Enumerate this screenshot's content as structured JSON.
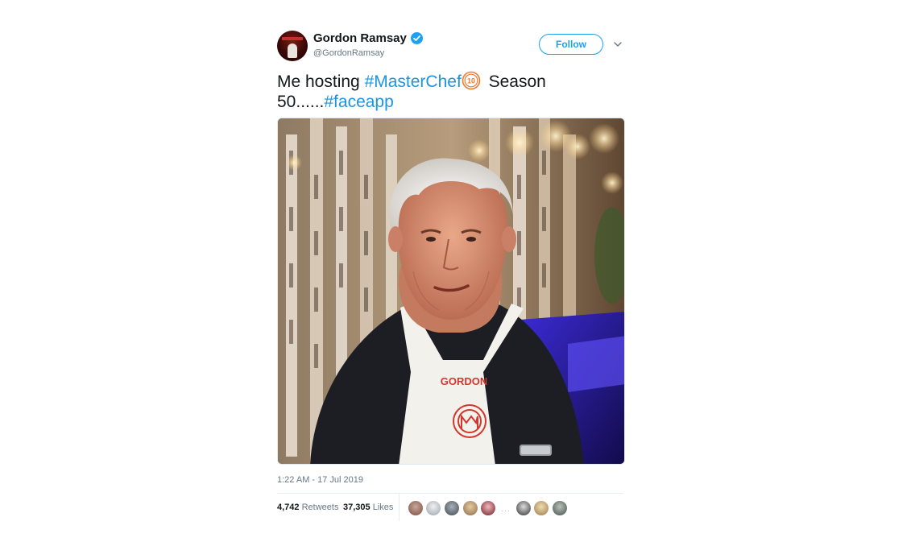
{
  "author": {
    "name": "Gordon Ramsay",
    "handle": "@GordonRamsay",
    "avatar_icon": "avatar-image",
    "verified": true
  },
  "actions": {
    "follow_label": "Follow",
    "menu_icon": "chevron-down-icon"
  },
  "tweet": {
    "text_part1": "Me hosting ",
    "hashtag1": "#MasterChef",
    "emoji_icon": "masterchef-10-icon",
    "text_part2": " Season 50......",
    "hashtag2": "#faceapp"
  },
  "media": {
    "apron_text": "GORDON"
  },
  "meta": {
    "timestamp": "1:22 AM - 17 Jul 2019",
    "retweets_count": "4,742",
    "retweets_label": "Retweets",
    "likes_count": "37,305",
    "likes_label": "Likes"
  },
  "colors": {
    "accent": "#1da1f2",
    "hashtag": "#1b95e0",
    "muted": "#657786"
  }
}
